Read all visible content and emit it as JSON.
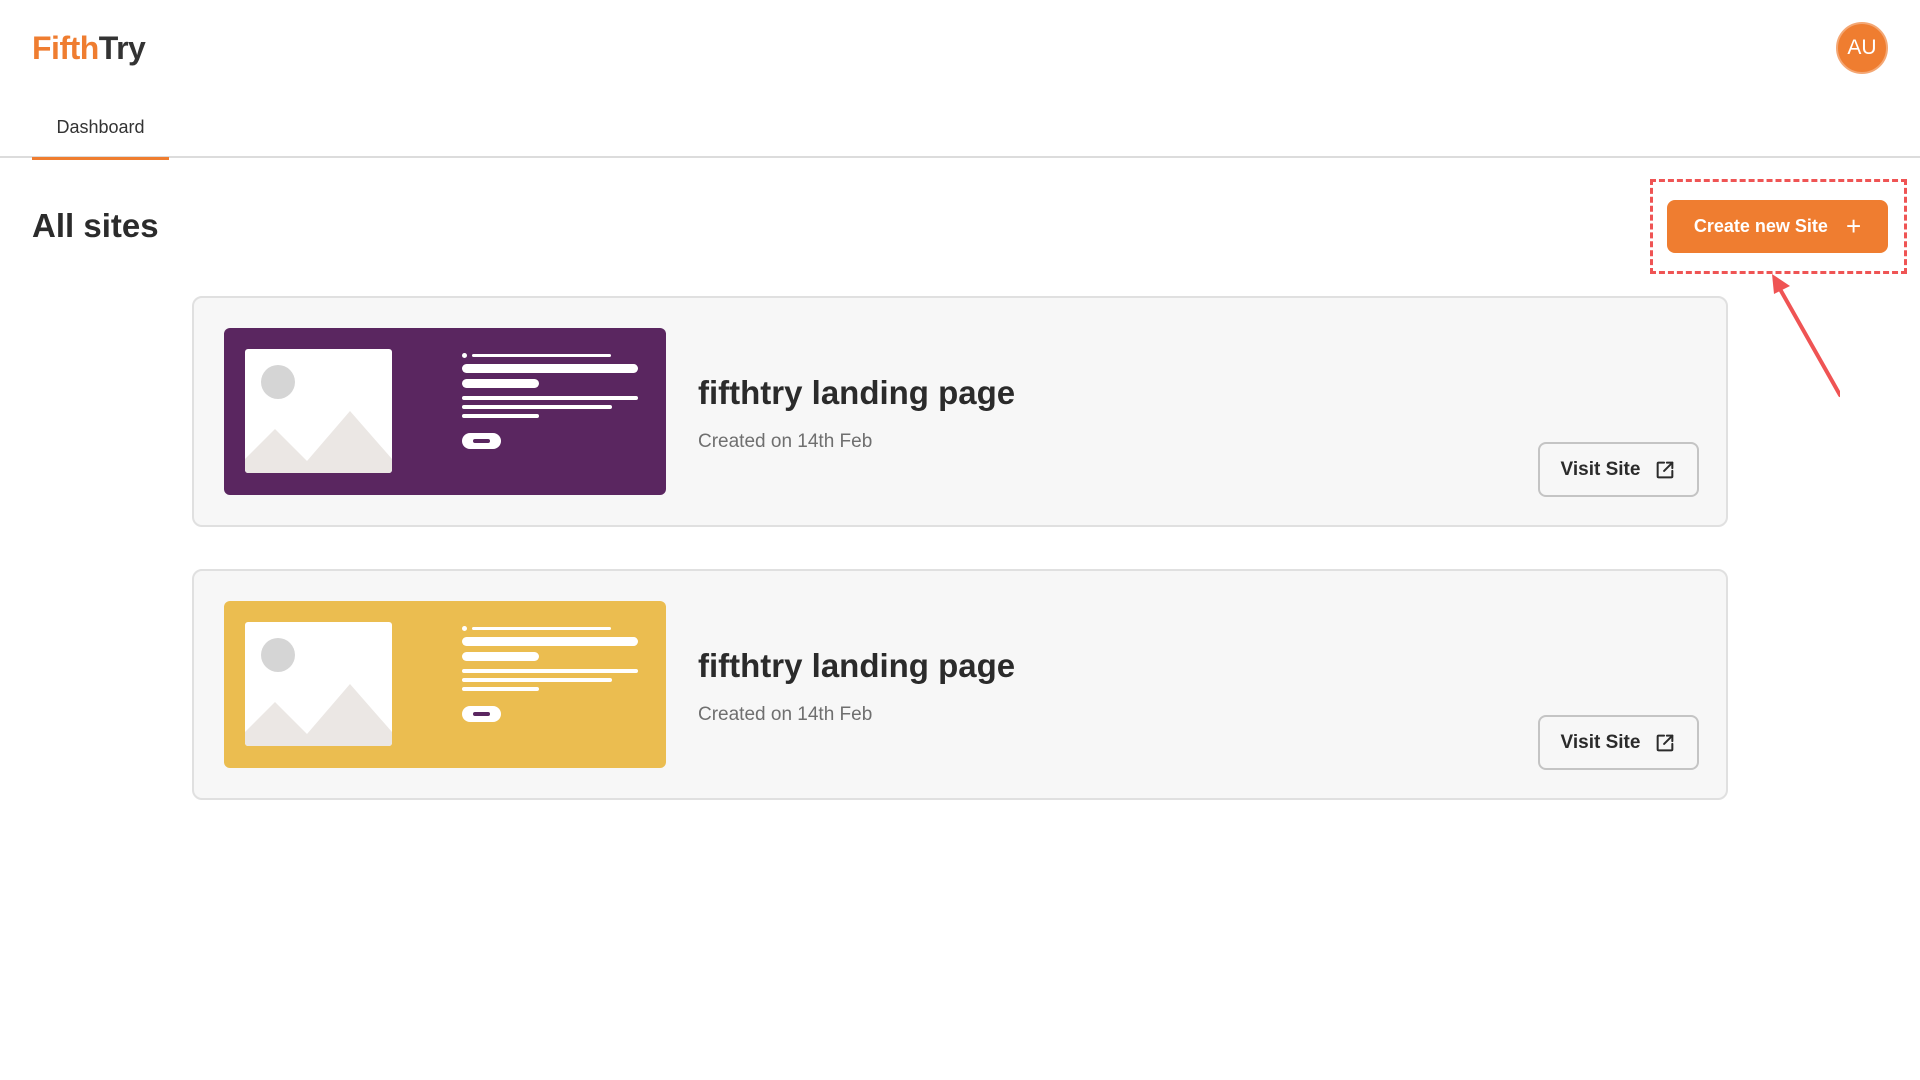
{
  "brand": {
    "part1": "Fifth",
    "part2": "Try",
    "accent": "#ef7d30"
  },
  "user": {
    "initials": "AU"
  },
  "tabs": [
    {
      "label": "Dashboard",
      "active": true
    }
  ],
  "main": {
    "title": "All sites",
    "create_button": {
      "label": "Create new Site",
      "icon": "plus-icon"
    }
  },
  "sites": [
    {
      "name": "fifthtry landing page",
      "created": "Created on 14th Feb",
      "thumbnail_color": "#5a2660",
      "visit_label": "Visit Site",
      "visit_icon": "external-link-icon"
    },
    {
      "name": "fifthtry landing page",
      "created": "Created on 14th Feb",
      "thumbnail_color": "#ebbd50",
      "visit_label": "Visit Site",
      "visit_icon": "external-link-icon"
    }
  ],
  "annotation": {
    "color": "#ef5454"
  }
}
